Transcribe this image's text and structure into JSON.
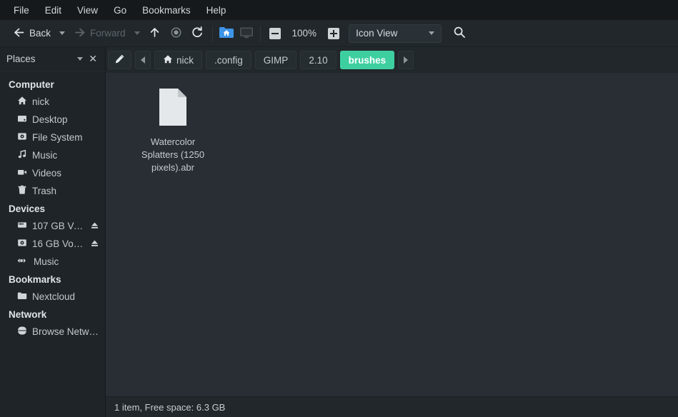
{
  "menubar": {
    "items": [
      {
        "label": "File",
        "name": "menu-file"
      },
      {
        "label": "Edit",
        "name": "menu-edit"
      },
      {
        "label": "View",
        "name": "menu-view"
      },
      {
        "label": "Go",
        "name": "menu-go"
      },
      {
        "label": "Bookmarks",
        "name": "menu-bookmarks"
      },
      {
        "label": "Help",
        "name": "menu-help"
      }
    ]
  },
  "toolbar": {
    "back_label": "Back",
    "forward_label": "Forward",
    "zoom_level": "100%",
    "view_mode": "Icon View",
    "icons": {
      "back": "arrow-left-icon",
      "forward": "arrow-right-icon",
      "up": "arrow-up-icon",
      "stop": "stop-icon",
      "reload": "reload-icon",
      "home": "home-folder-icon",
      "display": "monitor-icon",
      "zoom_out": "zoom-out-icon",
      "zoom_in": "zoom-in-icon",
      "search": "search-icon"
    }
  },
  "pathbar": {
    "edit_icon": "pencil-icon",
    "prev_icon": "chevron-left-icon",
    "next_icon": "chevron-right-icon",
    "crumbs": [
      {
        "label": "nick",
        "active": false,
        "home": true
      },
      {
        "label": ".config",
        "active": false,
        "home": false
      },
      {
        "label": "GIMP",
        "active": false,
        "home": false
      },
      {
        "label": "2.10",
        "active": false,
        "home": false
      },
      {
        "label": "brushes",
        "active": true,
        "home": false
      }
    ],
    "accent_color": "#3ecfa0"
  },
  "sidebar": {
    "title": "Places",
    "close_label": "✕",
    "groups": [
      {
        "title": "Computer",
        "rows": [
          {
            "label": "nick",
            "icon": "home-icon",
            "eject": false
          },
          {
            "label": "Desktop",
            "icon": "desktop-icon",
            "eject": false
          },
          {
            "label": "File System",
            "icon": "harddisk-icon",
            "eject": false
          },
          {
            "label": "Music",
            "icon": "music-note-icon",
            "eject": false
          },
          {
            "label": "Videos",
            "icon": "video-camera-icon",
            "eject": false
          },
          {
            "label": "Trash",
            "icon": "trash-icon",
            "eject": false
          }
        ]
      },
      {
        "title": "Devices",
        "rows": [
          {
            "label": "107 GB Vo…",
            "icon": "drive-icon",
            "eject": true
          },
          {
            "label": "16 GB Vol…",
            "icon": "disc-icon",
            "eject": true
          },
          {
            "label": "Music",
            "icon": "audio-device-icon",
            "eject": false
          }
        ]
      },
      {
        "title": "Bookmarks",
        "rows": [
          {
            "label": "Nextcloud",
            "icon": "folder-icon",
            "eject": false
          }
        ]
      },
      {
        "title": "Network",
        "rows": [
          {
            "label": "Browse Netw…",
            "icon": "globe-icon",
            "eject": false
          }
        ]
      }
    ]
  },
  "files": [
    {
      "name": "Watercolor Splatters (1250 pixels).abr",
      "icon": "document-icon"
    }
  ],
  "statusbar": {
    "text": "1 item, Free space: 6.3 GB"
  }
}
